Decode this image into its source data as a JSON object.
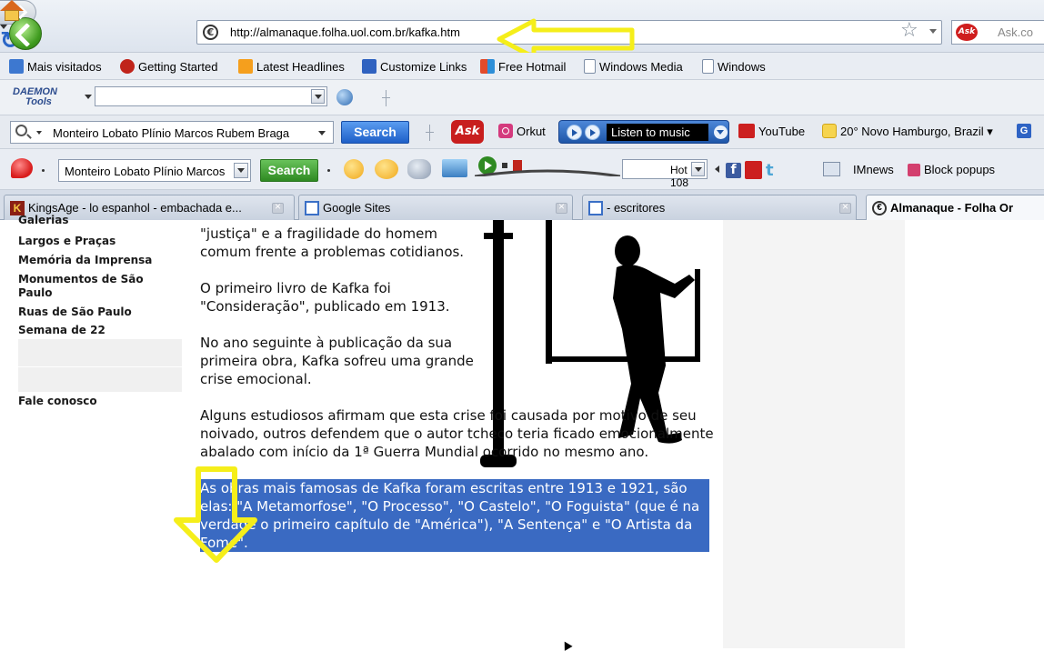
{
  "browser": {
    "url": "http://almanaque.folha.uol.com.br/kafka.htm",
    "search_placeholder": "Ask.co"
  },
  "bookmarks": [
    {
      "label": "Mais visitados",
      "icon": "most-visited-icon"
    },
    {
      "label": "Getting Started",
      "icon": "firefox-icon"
    },
    {
      "label": "Latest Headlines",
      "icon": "rss-icon"
    },
    {
      "label": "Customize Links",
      "icon": "msn-icon"
    },
    {
      "label": "Free Hotmail",
      "icon": "windows-icon"
    },
    {
      "label": "Windows Media",
      "icon": "page-icon"
    },
    {
      "label": "Windows",
      "icon": "page-icon"
    }
  ],
  "daemon": {
    "logo_line1": "DAEMON",
    "logo_line2": "Tools"
  },
  "search_toolbar": {
    "query": "Monteiro Lobato Plínio Marcos Rubem Braga",
    "search_label": "Search",
    "ask_label": "Ask",
    "orkut": "Orkut",
    "music": "Listen to music",
    "youtube": "YouTube",
    "weather": "20° Novo Hamburgo, Brazil",
    "g": "G"
  },
  "toolbar2": {
    "query": "Monteiro Lobato Plínio Marcos",
    "search_label": "Search",
    "hot": "Hot 108",
    "imnews": "IMnews",
    "block": "Block popups",
    "fb": "f"
  },
  "tabs": [
    {
      "label": "KingsAge - lo espanhol - embachada e...",
      "icon": "K",
      "active": false
    },
    {
      "label": "Google Sites",
      "active": false
    },
    {
      "label": "- escritores",
      "active": false
    },
    {
      "label": "Almanaque - Folha Or",
      "active": true
    }
  ],
  "nav": {
    "cut": "Galerias",
    "items": [
      "Largos e Praças",
      "Memória da Imprensa",
      "Monumentos de São Paulo",
      "Ruas de São Paulo",
      "Semana de 22"
    ],
    "contact": "Fale conosco"
  },
  "article": {
    "p0": "\"justiça\" e a fragilidade do homem comum frente a problemas cotidianos.",
    "p1": "O primeiro livro de Kafka foi \"Consideração\", publicado em 1913.",
    "p2": "No ano seguinte à publicação da sua primeira obra, Kafka sofreu uma grande crise emocional.",
    "p3": "Alguns estudiosos afirmam que esta crise foi causada por motivo de seu noivado, outros defendem que o autor tcheco teria ficado emocionalmente abalado com início da 1ª Guerra Mundial ocorrido no mesmo ano.",
    "p4": "As obras mais famosas de Kafka foram escritas entre 1913 e 1921, são elas: \"A Metamorfose\", \"O Processo\", \"O Castelo\", \"O Foguista\" (que é na verdade o primeiro capítulo de \"América\"), \"A Sentença\" e \"O Artista da Fome\"."
  },
  "colors": {
    "selection": "#3a6ac2",
    "annotation_arrow": "#f5ee1a"
  }
}
